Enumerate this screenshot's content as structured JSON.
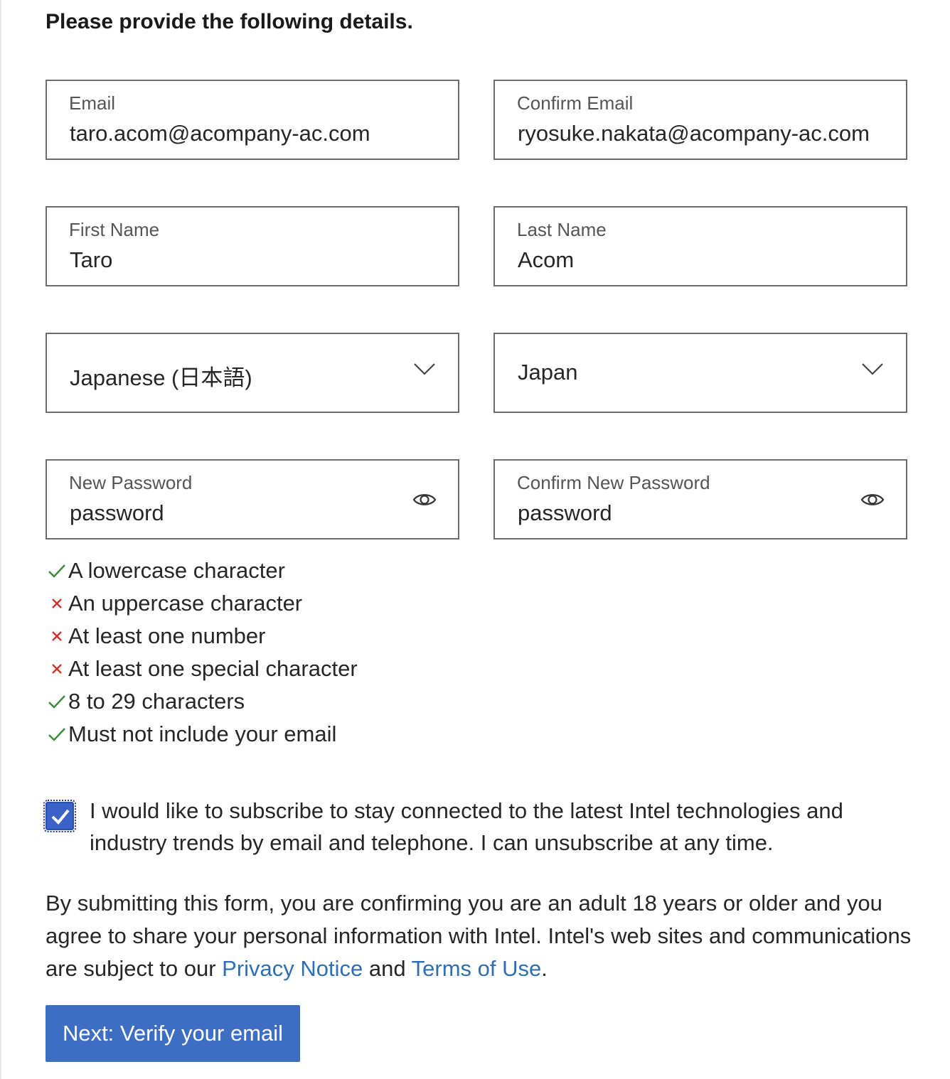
{
  "form": {
    "heading": "Please provide the following details.",
    "email": {
      "label": "Email",
      "value": "taro.acom@acompany-ac.com"
    },
    "confirm_email": {
      "label": "Confirm Email",
      "value": "ryosuke.nakata@acompany-ac.com"
    },
    "first_name": {
      "label": "First Name",
      "value": "Taro"
    },
    "last_name": {
      "label": "Last Name",
      "value": "Acom"
    },
    "language": {
      "value": "Japanese (日本語)",
      "icon": "chevron-down-icon"
    },
    "country": {
      "value": "Japan",
      "icon": "chevron-down-icon"
    },
    "new_password": {
      "label": "New Password",
      "value": "password",
      "icon": "eye-icon"
    },
    "confirm_password": {
      "label": "Confirm New Password",
      "value": "password",
      "icon": "eye-icon"
    }
  },
  "password_rules": [
    {
      "text": "A lowercase character",
      "met": true
    },
    {
      "text": "An uppercase character",
      "met": false
    },
    {
      "text": "At least one number",
      "met": false
    },
    {
      "text": "At least one special character",
      "met": false
    },
    {
      "text": "8 to 29 characters",
      "met": true
    },
    {
      "text": "Must not include your email",
      "met": true
    }
  ],
  "subscribe": {
    "checked": true,
    "text": "I would like to subscribe to stay connected to the latest Intel technologies and industry trends by email and telephone. I can unsubscribe at any time."
  },
  "legal": {
    "text_before": "By submitting this form, you are confirming you are an adult 18 years or older and you agree to share your personal information with Intel. Intel's web sites and communications are subject to our ",
    "privacy_link": "Privacy Notice",
    "middle": " and ",
    "terms_link": "Terms of Use",
    "end": "."
  },
  "next_button": {
    "label": "Next: Verify your email"
  },
  "colors": {
    "check_met": "#3a8a3a",
    "check_unmet": "#d0312d",
    "link": "#2f6fb1",
    "button_bg": "#3e6ec4",
    "checkbox_bg": "#3a63c9",
    "field_border": "#6b6b6b"
  }
}
